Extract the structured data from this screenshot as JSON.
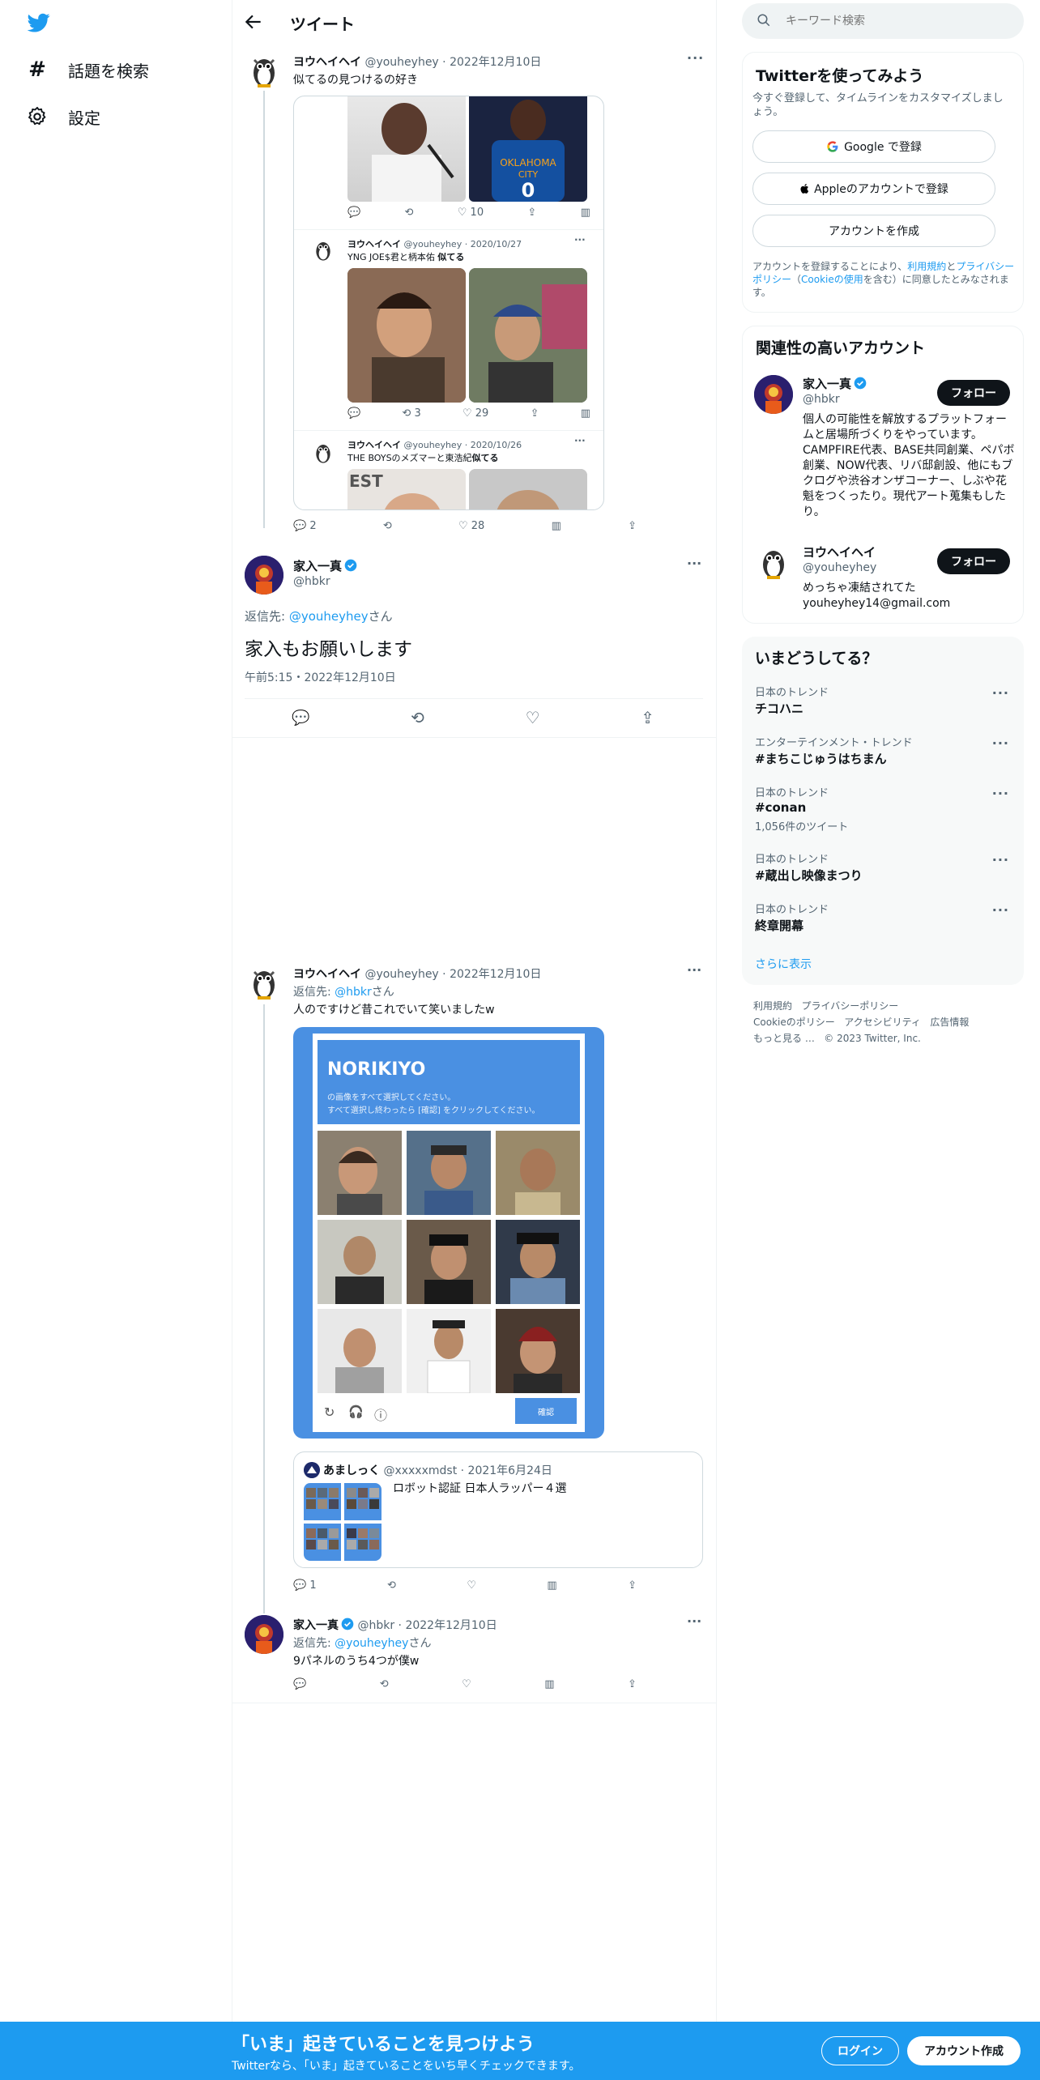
{
  "nav": {
    "search_label": "話題を検索",
    "settings_label": "設定"
  },
  "header": {
    "title": "ツイート"
  },
  "search": {
    "placeholder": "キーワード検索"
  },
  "signup": {
    "title": "Twitterを使ってみよう",
    "subtitle": "今すぐ登録して、タイムラインをカスタマイズしましょう。",
    "google": "Google で登録",
    "apple": "Appleのアカウントで登録",
    "create": "アカウントを作成",
    "terms_pre": "アカウントを登録することにより、",
    "terms_link": "利用規約",
    "terms_and": "と",
    "privacy_link": "プライバシーポリシー",
    "cookie_pre": "（",
    "cookie_link": "Cookieの使用",
    "terms_post": "を含む）に同意したとみなされます。"
  },
  "relevant": {
    "title": "関連性の高いアカウント",
    "follow_label": "フォロー",
    "accounts": [
      {
        "name": "家入一真",
        "handle": "@hbkr",
        "bio": "個人の可能性を解放するプラットフォームと居場所づくりをやっています。CAMPFIRE代表、BASE共同創業、ペパボ創業、NOW代表、リバ邸創設、他にもブクログや渋谷オンザコーナー、しぶや花魁をつくったり。現代アート蒐集もしたり。"
      },
      {
        "name": "ヨウヘイヘイ",
        "handle": "@youheyhey",
        "bio": "めっちゃ凍結されてた youheyhey14@gmail.com"
      }
    ]
  },
  "trends": {
    "title": "いまどうしてる？",
    "items": [
      {
        "category": "日本のトレンド",
        "name": "チコハニ",
        "count": ""
      },
      {
        "category": "エンターテインメント・トレンド",
        "name": "#まちこじゅうはちまん",
        "count": ""
      },
      {
        "category": "日本のトレンド",
        "name": "#conan",
        "count": "1,056件のツイート"
      },
      {
        "category": "日本のトレンド",
        "name": "#蔵出し映像まつり",
        "count": ""
      },
      {
        "category": "日本のトレンド",
        "name": "終章開幕",
        "count": ""
      }
    ],
    "show_more": "さらに表示"
  },
  "footer_links": {
    "terms": "利用規約",
    "privacy": "プライバシーポリシー",
    "cookie": "Cookieのポリシー",
    "access": "アクセシビリティ",
    "ads": "広告情報",
    "more": "もっと見る …",
    "copyright": "© 2023 Twitter, Inc."
  },
  "tweet1": {
    "name": "ヨウヘイヘイ",
    "handle": "@youheyhey",
    "date": "2022年12月10日",
    "text": "似てるの見つけるの好き",
    "replies": "2",
    "likes": "28",
    "inner_likes": "10",
    "inner1": {
      "name": "ヨウヘイヘイ",
      "handle": "@youheyhey",
      "date": "2020/10/27",
      "text": "YNG JOE$君と柄本佑 ",
      "text_bold": "似てる",
      "retweets": "3",
      "likes": "29"
    },
    "inner2": {
      "name": "ヨウヘイヘイ",
      "handle": "@youheyhey",
      "date": "2020/10/26",
      "text": "THE BOYSのメズマーと東浩紀",
      "text_bold": "似てる"
    }
  },
  "main_tweet": {
    "name": "家入一真",
    "handle": "@hbkr",
    "reply_to_pre": "返信先: ",
    "reply_to": "@youheyhey",
    "reply_to_post": "さん",
    "text": "家入もお願いします",
    "time": "午前5:15・2022年12月10日"
  },
  "tweet3": {
    "name": "ヨウヘイヘイ",
    "handle": "@youheyhey",
    "date": "2022年12月10日",
    "reply_to_pre": "返信先: ",
    "reply_to": "@hbkr",
    "reply_to_post": "さん",
    "text": "人のですけど昔これでいて笑いましたw",
    "captcha_title": "NORIKIYO",
    "captcha_line1": "の画像をすべて選択してください。",
    "captcha_line2": "すべて選択し終わったら [確認] をクリックしてください。",
    "captcha_button": "確認",
    "quote": {
      "name": "あましっく",
      "handle": "@xxxxxmdst",
      "date": "2021年6月24日",
      "text": "ロボット認証 日本人ラッパー４選"
    },
    "replies": "1"
  },
  "tweet4": {
    "name": "家入一真",
    "handle": "@hbkr",
    "date": "2022年12月10日",
    "reply_to_pre": "返信先: ",
    "reply_to": "@youheyhey",
    "reply_to_post": "さん",
    "text": "9パネルのうち4つが僕w"
  },
  "bottom_bar": {
    "title": "「いま」起きていることを見つけよう",
    "subtitle": "Twitterなら、「いま」起きていることをいち早くチェックできます。",
    "login": "ログイン",
    "signup": "アカウント作成"
  },
  "colors": {
    "accent": "#1d9bf0",
    "text": "#0f1419",
    "muted": "#536471",
    "card_bg": "#f7f9f9",
    "captcha_blue": "#4a90e2"
  }
}
